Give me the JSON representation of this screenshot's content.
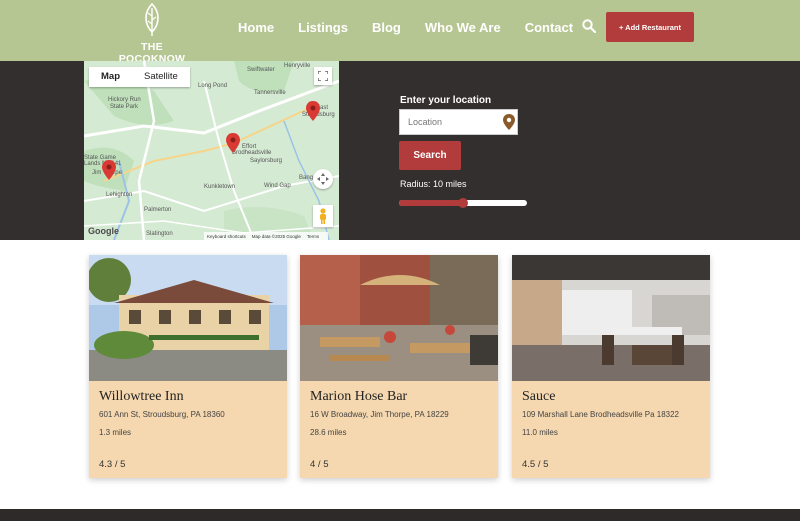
{
  "brand": {
    "name": "THE POCOKNOW",
    "logo_icon": "leaf-icon"
  },
  "nav": {
    "items": [
      "Home",
      "Listings",
      "Blog",
      "Who We Are",
      "Contact"
    ],
    "add_button": "+ Add Restaurant"
  },
  "map": {
    "tabs": [
      "Map",
      "Satellite"
    ],
    "active_tab": "Map",
    "places": [
      "Swiftwater",
      "Henryville",
      "Hickory Run",
      "State Park",
      "Long Pond",
      "Tannersville",
      "East",
      "Stroudsburg",
      "Effort",
      "Brodheadsville",
      "Saylorsburg",
      "State Game",
      "Lands No 141",
      "Jim Thorpe",
      "Lehighton",
      "Kunkletown",
      "Wind Gap",
      "Bangor",
      "Palmerton",
      "Slatington"
    ],
    "attribution": [
      "Keyboard shortcuts",
      "Map data ©2025 Google",
      "Terms"
    ],
    "google_label": "Google",
    "accent": "#d93a34"
  },
  "location_form": {
    "label": "Enter your location",
    "placeholder": "Location",
    "search_button": "Search",
    "radius_label": "Radius: 10 miles",
    "radius_fraction": 0.5
  },
  "restaurants": [
    {
      "name": "Willowtree Inn",
      "address": "601 Ann St, Stroudsburg, PA 18360",
      "distance": "1.3 miles",
      "rating": "4.3 / 5"
    },
    {
      "name": "Marion Hose Bar",
      "address": "16 W Broadway, Jim Thorpe, PA 18229",
      "distance": "28.6 miles",
      "rating": "4 / 5"
    },
    {
      "name": "Sauce",
      "address": "109 Marshall Lane Brodheadsville Pa 18322",
      "distance": "11.0 miles",
      "rating": "4.5 / 5"
    }
  ],
  "colors": {
    "header": "#b6c692",
    "band": "#342f2f",
    "accent": "#b23b3b",
    "card": "#f5d8b0"
  }
}
